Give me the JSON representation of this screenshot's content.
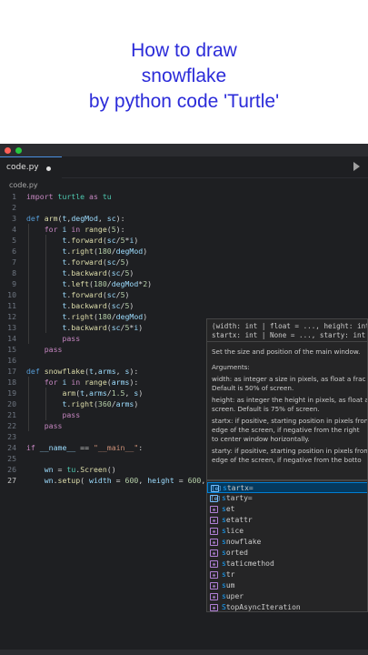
{
  "title": {
    "line1": "How to draw",
    "line2": "snowflake",
    "line3": "by python code 'Turtle'"
  },
  "colors": {
    "title_text": "#2b2bd9",
    "editor_bg": "#1e1f22",
    "close_button": "#ff5f57",
    "minimize_button": "#28c840",
    "tab_accent": "#4a90e2"
  },
  "editor": {
    "tab": {
      "label": "code.py"
    },
    "breadcrumb": "code.py",
    "run_icon": "play-icon",
    "cursor_line": 27
  },
  "code_lines": [
    {
      "n": "1",
      "text": "import turtle as tu"
    },
    {
      "n": "2",
      "text": ""
    },
    {
      "n": "3",
      "text": "def arm(t,degMod, sc):"
    },
    {
      "n": "4",
      "text": "    for i in range(5):"
    },
    {
      "n": "5",
      "text": "        t.forward(sc/5*i)"
    },
    {
      "n": "6",
      "text": "        t.right(180/degMod)"
    },
    {
      "n": "7",
      "text": "        t.forward(sc/5)"
    },
    {
      "n": "8",
      "text": "        t.backward(sc/5)"
    },
    {
      "n": "9",
      "text": "        t.left(180/degMod*2)"
    },
    {
      "n": "10",
      "text": "        t.forward(sc/5)"
    },
    {
      "n": "11",
      "text": "        t.backward(sc/5)"
    },
    {
      "n": "12",
      "text": "        t.right(180/degMod)"
    },
    {
      "n": "13",
      "text": "        t.backward(sc/5*i)"
    },
    {
      "n": "14",
      "text": "        pass"
    },
    {
      "n": "15",
      "text": "    pass"
    },
    {
      "n": "16",
      "text": ""
    },
    {
      "n": "17",
      "text": "def snowflake(t,arms, s):"
    },
    {
      "n": "18",
      "text": "    for i in range(arms):"
    },
    {
      "n": "19",
      "text": "        arm(t,arms/1.5, s)"
    },
    {
      "n": "20",
      "text": "        t.right(360/arms)"
    },
    {
      "n": "21",
      "text": "        pass"
    },
    {
      "n": "22",
      "text": "    pass"
    },
    {
      "n": "23",
      "text": ""
    },
    {
      "n": "24",
      "text": "if __name__ == \"__main__\":"
    },
    {
      "n": "25",
      "text": ""
    },
    {
      "n": "26",
      "text": "    wn = tu.Screen()"
    },
    {
      "n": "27",
      "text": "    wn.setup( width = 600, height = 600, s)"
    }
  ],
  "hover_doc": {
    "signature1": "(width: int | float = ..., height: int",
    "signature2": "startx: int | None = ..., starty: int",
    "summary": "Set the size and position of the main window.",
    "args_heading": "Arguments:",
    "lines": [
      "width: as integer a size in pixels, as float a frac",
      "  Default is 50% of screen.",
      "height: as integer the height in pixels, as float a",
      "  screen. Default is 75% of screen.",
      "startx: if positive, starting position in pixels from",
      "  edge of the screen, if negative from the right",
      "to center window horizontally.",
      "starty: if positive, starting position in pixels from",
      "  edge of the screen, if negative from the botto"
    ]
  },
  "suggestions": [
    {
      "label_match": "s",
      "label_rest": "tartx=",
      "icon": "variable-icon",
      "selected": true
    },
    {
      "label_match": "s",
      "label_rest": "tarty=",
      "icon": "variable-icon",
      "selected": false
    },
    {
      "label_match": "s",
      "label_rest": "et",
      "icon": "class-icon",
      "selected": false
    },
    {
      "label_match": "s",
      "label_rest": "etattr",
      "icon": "class-icon",
      "selected": false
    },
    {
      "label_match": "s",
      "label_rest": "lice",
      "icon": "class-icon",
      "selected": false
    },
    {
      "label_match": "s",
      "label_rest": "nowflake",
      "icon": "class-icon",
      "selected": false
    },
    {
      "label_match": "s",
      "label_rest": "orted",
      "icon": "class-icon",
      "selected": false
    },
    {
      "label_match": "s",
      "label_rest": "taticmethod",
      "icon": "class-icon",
      "selected": false
    },
    {
      "label_match": "s",
      "label_rest": "tr",
      "icon": "class-icon",
      "selected": false
    },
    {
      "label_match": "s",
      "label_rest": "um",
      "icon": "class-icon",
      "selected": false
    },
    {
      "label_match": "s",
      "label_rest": "uper",
      "icon": "class-icon",
      "selected": false
    },
    {
      "label_match": "S",
      "label_rest": "topAsyncIteration",
      "icon": "class-icon",
      "selected": false
    }
  ]
}
